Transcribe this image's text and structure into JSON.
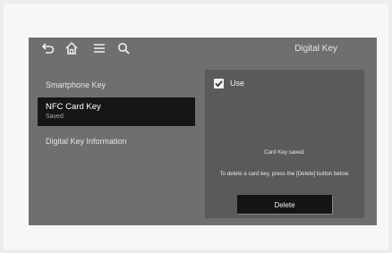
{
  "header": {
    "title": "Digital Key",
    "icons": [
      "back-icon",
      "home-icon",
      "menu-icon",
      "search-icon"
    ]
  },
  "menu": {
    "items": [
      {
        "label": "Smartphone Key"
      },
      {
        "label": "NFC Card Key",
        "sub": "Saved",
        "selected": true
      },
      {
        "label": "Digital Key Information"
      }
    ]
  },
  "panel": {
    "use_label": "Use",
    "use_checked": true,
    "message_1": "Card Key saved.",
    "message_2": "To delete a card key, press the [Delete] button below.",
    "delete_label": "Delete"
  }
}
